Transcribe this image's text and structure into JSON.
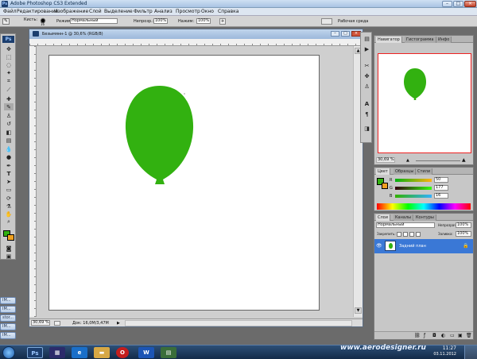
{
  "titlebar": {
    "title": "Adobe Photoshop CS3 Extended",
    "app_badge": "Ps"
  },
  "menu": [
    "Файл",
    "Редактирование",
    "Изображение",
    "Слой",
    "Выделение",
    "Фильтр",
    "Анализ",
    "Просмотр",
    "Окно",
    "Справка"
  ],
  "options": {
    "brush_label": "Кисть:",
    "brush_size": "16",
    "mode_label": "Режим:",
    "mode_value": "Нормальный",
    "opacity_label": "Непрозр.:",
    "opacity_value": "100%",
    "flow_label": "Нажим:",
    "flow_value": "100%",
    "workspace_label": "Рабочая среда"
  },
  "minimized_docs": [
    "IM...",
    "IM...",
    "stor...",
    "IM...",
    "IM..."
  ],
  "document": {
    "title": "Безымянн-1 @ 30,6% (RGB/8)",
    "zoom": "30,69 %",
    "doc_info": "Док: 16,0M/3,47M"
  },
  "navigator": {
    "tabs": [
      "Навигатор",
      "Гистограмма",
      "Инфо"
    ],
    "zoom": "30,69 %"
  },
  "color_panel": {
    "tabs": [
      "Цвет",
      "Образцы",
      "Стили"
    ],
    "channels": [
      {
        "label": "R",
        "value": "50"
      },
      {
        "label": "G",
        "value": "177"
      },
      {
        "label": "B",
        "value": "16"
      }
    ]
  },
  "layers_panel": {
    "tabs": [
      "Слои",
      "Каналы",
      "Контуры"
    ],
    "blend_mode": "Нормальный",
    "opacity_label": "Непрозрачность:",
    "opacity_value": "100%",
    "lock_label": "Закрепить:",
    "fill_label": "Заливка:",
    "fill_value": "100%",
    "layers": [
      {
        "name": "Задний план"
      }
    ]
  },
  "taskbar": {
    "time": "11:27",
    "date": "03.11.2012",
    "watermark": "www.aerodesigner.ru"
  },
  "colors": {
    "foreground": "#32b110",
    "background": "#f0a020",
    "balloon": "#32b110"
  }
}
